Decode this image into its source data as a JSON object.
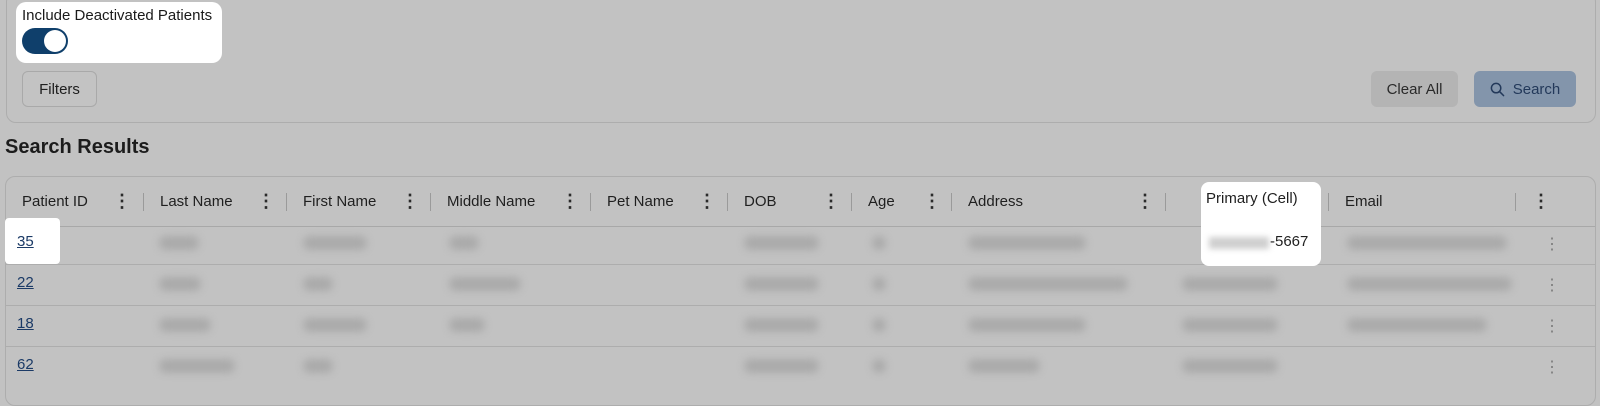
{
  "filters_panel": {
    "toggle_label": "Include Deactivated Patients",
    "toggle_on": true,
    "filters_button": "Filters",
    "clear_all_button": "Clear All",
    "search_button": "Search"
  },
  "results": {
    "title": "Search Results",
    "columns": [
      "Patient ID",
      "Last Name",
      "First Name",
      "Middle Name",
      "Pet Name",
      "DOB",
      "Age",
      "Address",
      "Primary (Cell)",
      "Email"
    ],
    "rows": [
      {
        "patient_id": "35",
        "primary_cell": "-5667"
      },
      {
        "patient_id": "22",
        "primary_cell": ""
      },
      {
        "patient_id": "18",
        "primary_cell": ""
      },
      {
        "patient_id": "62",
        "primary_cell": ""
      }
    ]
  },
  "colors": {
    "toggle_on": "#0f3f6b",
    "link": "#1b3a66",
    "search_button_bg": "#8395ab"
  }
}
